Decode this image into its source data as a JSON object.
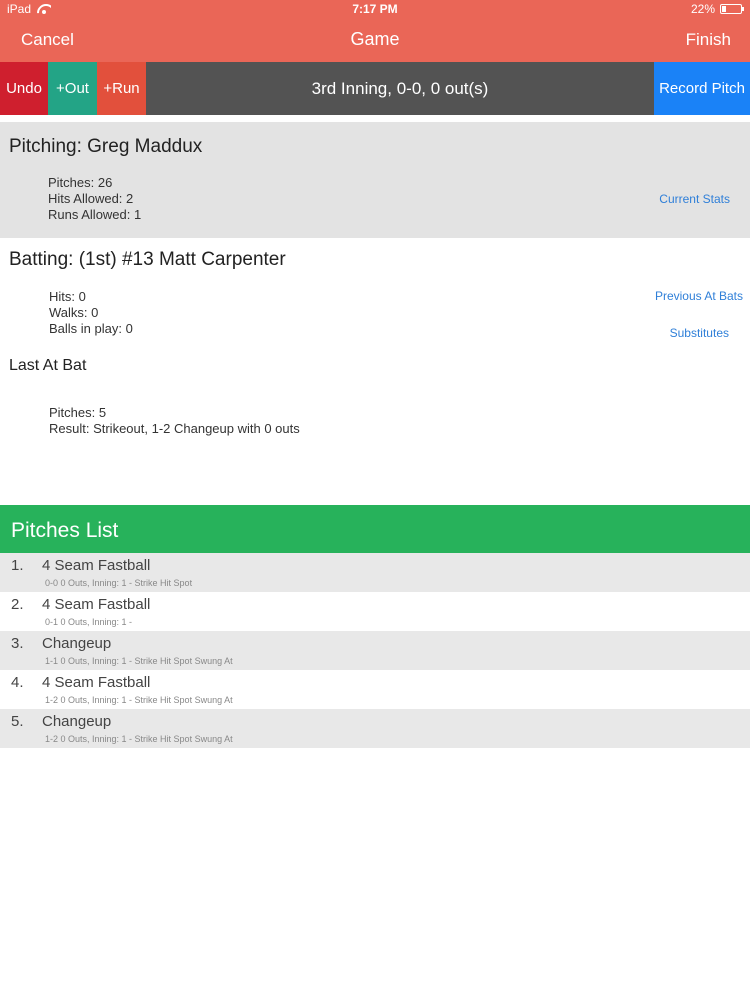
{
  "status_bar": {
    "device": "iPad",
    "time": "7:17 PM",
    "battery": "22%",
    "battery_level": 0.22
  },
  "nav": {
    "cancel": "Cancel",
    "title": "Game",
    "finish": "Finish"
  },
  "toolbar": {
    "undo": "Undo",
    "out": "+Out",
    "run": "+Run",
    "status": "3rd Inning, 0-0, 0 out(s)",
    "record": "Record Pitch"
  },
  "pitching": {
    "title": "Pitching: Greg Maddux",
    "pitches": "Pitches: 26",
    "hits": "Hits Allowed: 2",
    "runs": "Runs Allowed: 1",
    "link": "Current Stats"
  },
  "batting": {
    "title": "Batting: (1st) #13 Matt Carpenter",
    "hits": "Hits: 0",
    "walks": "Walks: 0",
    "balls": "Balls in play: 0",
    "link_prev": "Previous At Bats",
    "link_subs": "Substitutes"
  },
  "last_at_bat": {
    "title": "Last At Bat",
    "pitches": "Pitches: 5",
    "result": "Result: Strikeout, 1-2 Changeup with 0 outs"
  },
  "pitches_list": {
    "title": "Pitches List",
    "items": [
      {
        "num": "1.",
        "name": "4 Seam Fastball",
        "detail": "0-0 0 Outs, Inning: 1 -  Strike  Hit Spot"
      },
      {
        "num": "2.",
        "name": "4 Seam Fastball",
        "detail": "0-1 0 Outs, Inning: 1 -"
      },
      {
        "num": "3.",
        "name": "Changeup",
        "detail": "1-1 0 Outs, Inning: 1 -  Strike  Hit Spot  Swung At"
      },
      {
        "num": "4.",
        "name": "4 Seam Fastball",
        "detail": "1-2 0 Outs, Inning: 1 -  Strike  Hit Spot  Swung At"
      },
      {
        "num": "5.",
        "name": "Changeup",
        "detail": "1-2 0 Outs, Inning: 1 -  Strike  Hit Spot  Swung At"
      }
    ]
  },
  "colors": {
    "nav_bar": "#ea6657",
    "undo": "#cf1f2e",
    "out": "#23a486",
    "run": "#e2503c",
    "record": "#1a82f7",
    "toolbar": "#535353",
    "list_header": "#27b25b",
    "link": "#2f7fd8"
  }
}
